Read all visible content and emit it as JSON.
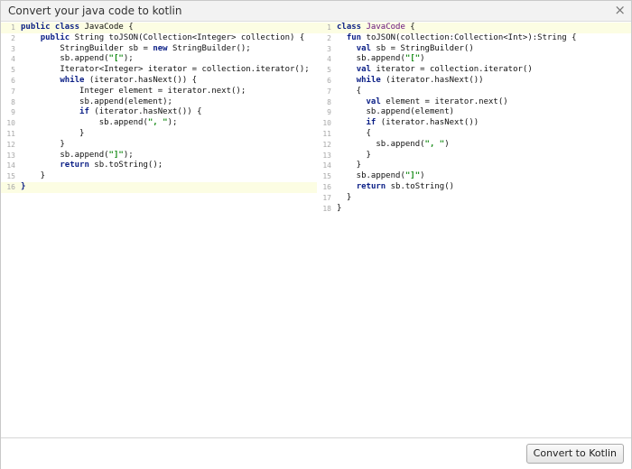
{
  "dialog": {
    "title": "Convert your java code to kotlin",
    "close_glyph": "×",
    "convert_label": "Convert to Kotlin"
  },
  "java_lines": [
    [
      [
        "kw",
        "public class "
      ],
      [
        "",
        "JavaCode {"
      ]
    ],
    [
      [
        "",
        "    "
      ],
      [
        "kw",
        "public "
      ],
      [
        "",
        "String toJSON(Collection<Integer> collection) {"
      ]
    ],
    [
      [
        "",
        "        StringBuilder sb = "
      ],
      [
        "kw",
        "new "
      ],
      [
        "",
        "StringBuilder();"
      ]
    ],
    [
      [
        "",
        "        sb.append("
      ],
      [
        "str",
        "\"[\""
      ],
      [
        "",
        ");"
      ]
    ],
    [
      [
        "",
        "        Iterator<Integer> iterator = collection.iterator();"
      ]
    ],
    [
      [
        "",
        "        "
      ],
      [
        "kw",
        "while "
      ],
      [
        "",
        "(iterator.hasNext()) {"
      ]
    ],
    [
      [
        "",
        "            Integer element = iterator.next();"
      ]
    ],
    [
      [
        "",
        "            sb.append(element);"
      ]
    ],
    [
      [
        "",
        "            "
      ],
      [
        "kw",
        "if "
      ],
      [
        "",
        "(iterator.hasNext()) {"
      ]
    ],
    [
      [
        "",
        "                sb.append("
      ],
      [
        "str",
        "\", \""
      ],
      [
        "",
        ");"
      ]
    ],
    [
      [
        "",
        "            }"
      ]
    ],
    [
      [
        "",
        "        }"
      ]
    ],
    [
      [
        "",
        "        sb.append("
      ],
      [
        "str",
        "\"]\""
      ],
      [
        "",
        ");"
      ]
    ],
    [
      [
        "",
        "        "
      ],
      [
        "kw",
        "return "
      ],
      [
        "",
        "sb.toString();"
      ]
    ],
    [
      [
        "",
        "    }"
      ]
    ],
    [
      [
        "kw",
        "}"
      ]
    ]
  ],
  "kotlin_lines": [
    [
      [
        "kw",
        "class "
      ],
      [
        "decl",
        "JavaCode"
      ],
      [
        "",
        " {"
      ]
    ],
    [
      [
        "",
        "  "
      ],
      [
        "kw",
        "fun "
      ],
      [
        "",
        "toJSON(collection:Collection<Int>):String {"
      ]
    ],
    [
      [
        "",
        "    "
      ],
      [
        "kw",
        "val "
      ],
      [
        "",
        "sb = StringBuilder()"
      ]
    ],
    [
      [
        "",
        "    sb.append("
      ],
      [
        "str",
        "\"[\""
      ],
      [
        "",
        ")"
      ]
    ],
    [
      [
        "",
        "    "
      ],
      [
        "kw",
        "val "
      ],
      [
        "",
        "iterator = collection.iterator()"
      ]
    ],
    [
      [
        "",
        "    "
      ],
      [
        "kw",
        "while "
      ],
      [
        "",
        "(iterator.hasNext())"
      ]
    ],
    [
      [
        "",
        "    {"
      ]
    ],
    [
      [
        "",
        "      "
      ],
      [
        "kw",
        "val "
      ],
      [
        "",
        "element = iterator.next()"
      ]
    ],
    [
      [
        "",
        "      sb.append(element)"
      ]
    ],
    [
      [
        "",
        "      "
      ],
      [
        "kw",
        "if "
      ],
      [
        "",
        "(iterator.hasNext())"
      ]
    ],
    [
      [
        "",
        "      {"
      ]
    ],
    [
      [
        "",
        "        sb.append("
      ],
      [
        "str",
        "\", \""
      ],
      [
        "",
        ")"
      ]
    ],
    [
      [
        "",
        "      }"
      ]
    ],
    [
      [
        "",
        "    }"
      ]
    ],
    [
      [
        "",
        "    sb.append("
      ],
      [
        "str",
        "\"]\""
      ],
      [
        "",
        ")"
      ]
    ],
    [
      [
        "",
        "    "
      ],
      [
        "kw",
        "return "
      ],
      [
        "",
        "sb.toString()"
      ]
    ],
    [
      [
        "",
        "  }"
      ]
    ],
    [
      [
        "",
        "}"
      ]
    ]
  ],
  "highlighted": {
    "java": [
      1,
      16
    ],
    "kotlin": [
      1
    ]
  }
}
